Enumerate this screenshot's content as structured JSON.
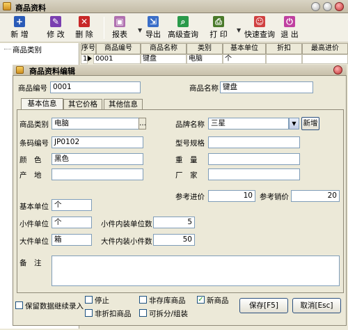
{
  "window": {
    "title": "商品资料"
  },
  "toolbar": {
    "new": "新 增",
    "edit": "修 改",
    "delete": "删 除",
    "report": "报表",
    "export": "导出",
    "advanced_search": "高级查询",
    "print": "打 印",
    "quick_search": "快速查询",
    "exit": "退 出"
  },
  "left_pane": {
    "header": "商品类别"
  },
  "grid": {
    "columns": [
      "序号",
      "商品编号",
      "商品名称",
      "类别",
      "基本单位",
      "折扣",
      "最高进价"
    ],
    "rows": [
      {
        "index": "1",
        "code": "0001",
        "name": "键盘",
        "category": "电脑",
        "unit": "个"
      }
    ]
  },
  "dialog": {
    "title": "商品资料编辑",
    "product_code_label": "商品编号",
    "product_code": "0001",
    "product_name_label": "商品名称",
    "product_name": "键盘",
    "tabs": [
      "基本信息",
      "其它价格",
      "其他信息"
    ],
    "category_label": "商品类别",
    "category": "电脑",
    "category_browse": "...",
    "brand_label": "品牌名称",
    "brand": "三星",
    "brand_add": "新增",
    "barcode_label": "条码编号",
    "barcode": "JP0102",
    "model_label": "型号规格",
    "model": "",
    "color_label": "颜　色",
    "color": "黑色",
    "weight_label": "重　量",
    "weight": "",
    "origin_label": "产　地",
    "origin": "",
    "maker_label": "厂　家",
    "maker": "",
    "ref_cost_label": "参考进价",
    "ref_cost": "10",
    "ref_price_label": "参考销价",
    "ref_price": "20",
    "base_unit_label": "基本单位",
    "base_unit": "个",
    "small_unit_label": "小件单位",
    "small_unit": "个",
    "small_qty_label": "小件内装单位数",
    "small_qty": "5",
    "large_unit_label": "大件单位",
    "large_unit": "箱",
    "large_qty_label": "大件内装小件数",
    "large_qty": "50",
    "remark_label": "备　注",
    "remark": "",
    "keep_data_label": "保留数据继续录入",
    "stop_label": "停止",
    "no_discount_label": "非折扣商品",
    "non_stock_label": "非存库商品",
    "splittable_label": "可拆分/组装",
    "new_item_label": "新商品",
    "save_button": "保存[F5]",
    "cancel_button": "取消[Esc]"
  },
  "colors": {
    "accent": "#1c5180",
    "check": "#21a121",
    "title_bg": "#c8c0aa"
  }
}
